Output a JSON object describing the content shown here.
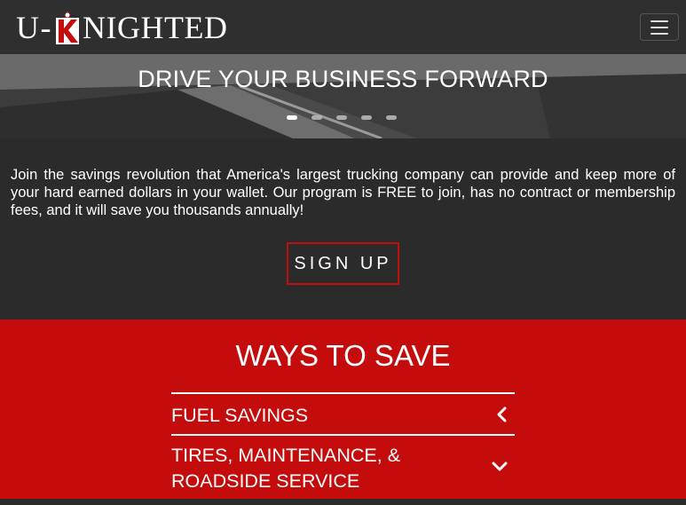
{
  "nav": {
    "logo": {
      "prefix": "U",
      "dash": "-",
      "suffix": "NIGHTED",
      "badge_letter": "K"
    },
    "menu_icon": "hamburger-icon"
  },
  "hero": {
    "title": "DRIVE YOUR BUSINESS FORWARD",
    "slides": 5,
    "active_slide": 1
  },
  "intro": {
    "text": "Join the savings revolution that America's largest trucking company can provide and keep more of your hard earned dollars in your wallet. Our program is FREE to join, has no contract or membership fees, and it will save you thousands annually!",
    "signup_label": "SIGN UP"
  },
  "ways": {
    "title": "WAYS TO SAVE",
    "items": [
      {
        "label": "FUEL SAVINGS",
        "icon": "chevron-left-icon"
      },
      {
        "label": "TIRES, MAINTENANCE, & ROADSIDE SERVICE",
        "icon": "chevron-down-icon"
      }
    ]
  },
  "colors": {
    "brand_red": "#c50c0c",
    "dark_bg": "#2b2b2b",
    "navbar": "#2f2f2f"
  }
}
